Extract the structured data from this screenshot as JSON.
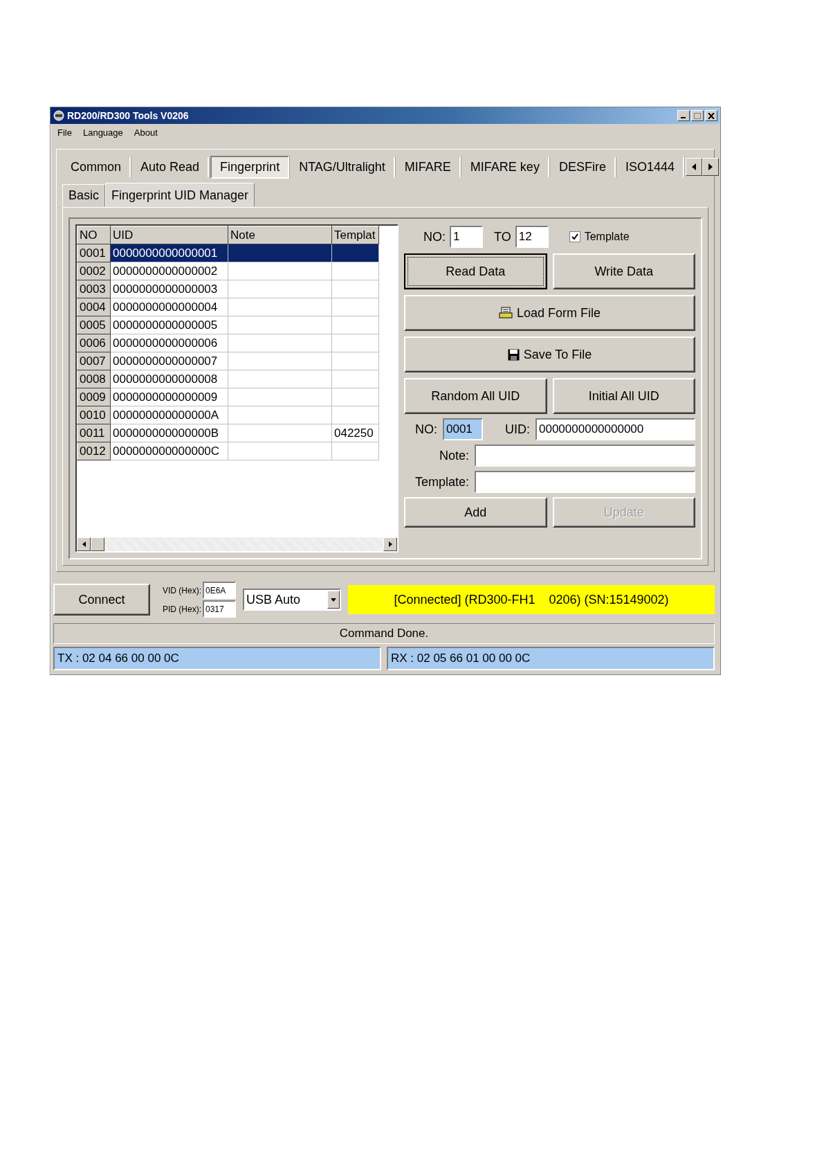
{
  "window": {
    "title": "RD200/RD300 Tools V0206"
  },
  "menu": [
    "File",
    "Language",
    "About"
  ],
  "tabs": [
    {
      "label": "Common",
      "selected": false
    },
    {
      "label": "Auto Read",
      "selected": false
    },
    {
      "label": "Fingerprint",
      "selected": true
    },
    {
      "label": "NTAG/Ultralight",
      "selected": false
    },
    {
      "label": "MIFARE",
      "selected": false
    },
    {
      "label": "MIFARE key",
      "selected": false
    },
    {
      "label": "DESFire",
      "selected": false
    },
    {
      "label": "ISO1444",
      "selected": false
    }
  ],
  "subtabs": [
    {
      "label": "Basic",
      "selected": false
    },
    {
      "label": "Fingerprint UID Manager",
      "selected": true
    }
  ],
  "table": {
    "columns": [
      "NO",
      "UID",
      "Note",
      "Templat"
    ],
    "rows": [
      {
        "no": "0001",
        "uid": "0000000000000001",
        "selected": true
      },
      {
        "no": "0002",
        "uid": "0000000000000002",
        "selected": false
      },
      {
        "no": "0003",
        "uid": "0000000000000003",
        "selected": false
      },
      {
        "no": "0004",
        "uid": "0000000000000004",
        "selected": false
      },
      {
        "no": "0005",
        "uid": "0000000000000005",
        "selected": false
      },
      {
        "no": "0006",
        "uid": "0000000000000006",
        "selected": false
      },
      {
        "no": "0007",
        "uid": "0000000000000007",
        "selected": false
      },
      {
        "no": "0008",
        "uid": "0000000000000008",
        "selected": false
      },
      {
        "no": "0009",
        "uid": "0000000000000009",
        "selected": false
      },
      {
        "no": "0010",
        "uid": "000000000000000A",
        "selected": false
      },
      {
        "no": "0011",
        "uid": "000000000000000B",
        "template": "042250",
        "selected": false
      },
      {
        "no": "0012",
        "uid": "000000000000000C",
        "selected": false
      }
    ]
  },
  "range": {
    "from_label": "NO:",
    "from": "1",
    "to_label": "TO",
    "to": "12",
    "checkbox": {
      "label": "Template",
      "checked": true
    }
  },
  "buttons": [
    {
      "label": "Read Data",
      "kind": "plain",
      "wide": false,
      "focused": true
    },
    {
      "label": "Write Data",
      "kind": "plain",
      "wide": false,
      "focused": false
    },
    {
      "label": "Load Form File",
      "kind": "load",
      "wide": true,
      "focused": false
    },
    {
      "label": "Save To File",
      "kind": "save",
      "wide": true,
      "focused": false
    },
    {
      "label": "Random All UID",
      "kind": "plain",
      "wide": false,
      "focused": false
    },
    {
      "label": "Initial All UID",
      "kind": "plain",
      "wide": false,
      "focused": false
    }
  ],
  "editor": {
    "no_label": "NO:",
    "no": "0001",
    "no_text_selected": true,
    "uid_label": "UID:",
    "uid": "0000000000000000",
    "note_label": "Note:",
    "template_label": "Template:"
  },
  "actions": [
    {
      "label": "Add",
      "disabled": false
    },
    {
      "label": "Update",
      "disabled": true
    }
  ],
  "connection": {
    "button": "Connect",
    "vid_label": "VID (Hex):",
    "vid": "0E6A",
    "pid_label": "PID (Hex):",
    "pid": "0317",
    "port": "USB Auto",
    "status": "[Connected] (RD300-FH1    0206) (SN:15149002)"
  },
  "status_bar": "Command Done.",
  "tx": "TX : 02 04 66 00 00 0C",
  "rx": "RX : 02 05 66 01 00 00 0C"
}
